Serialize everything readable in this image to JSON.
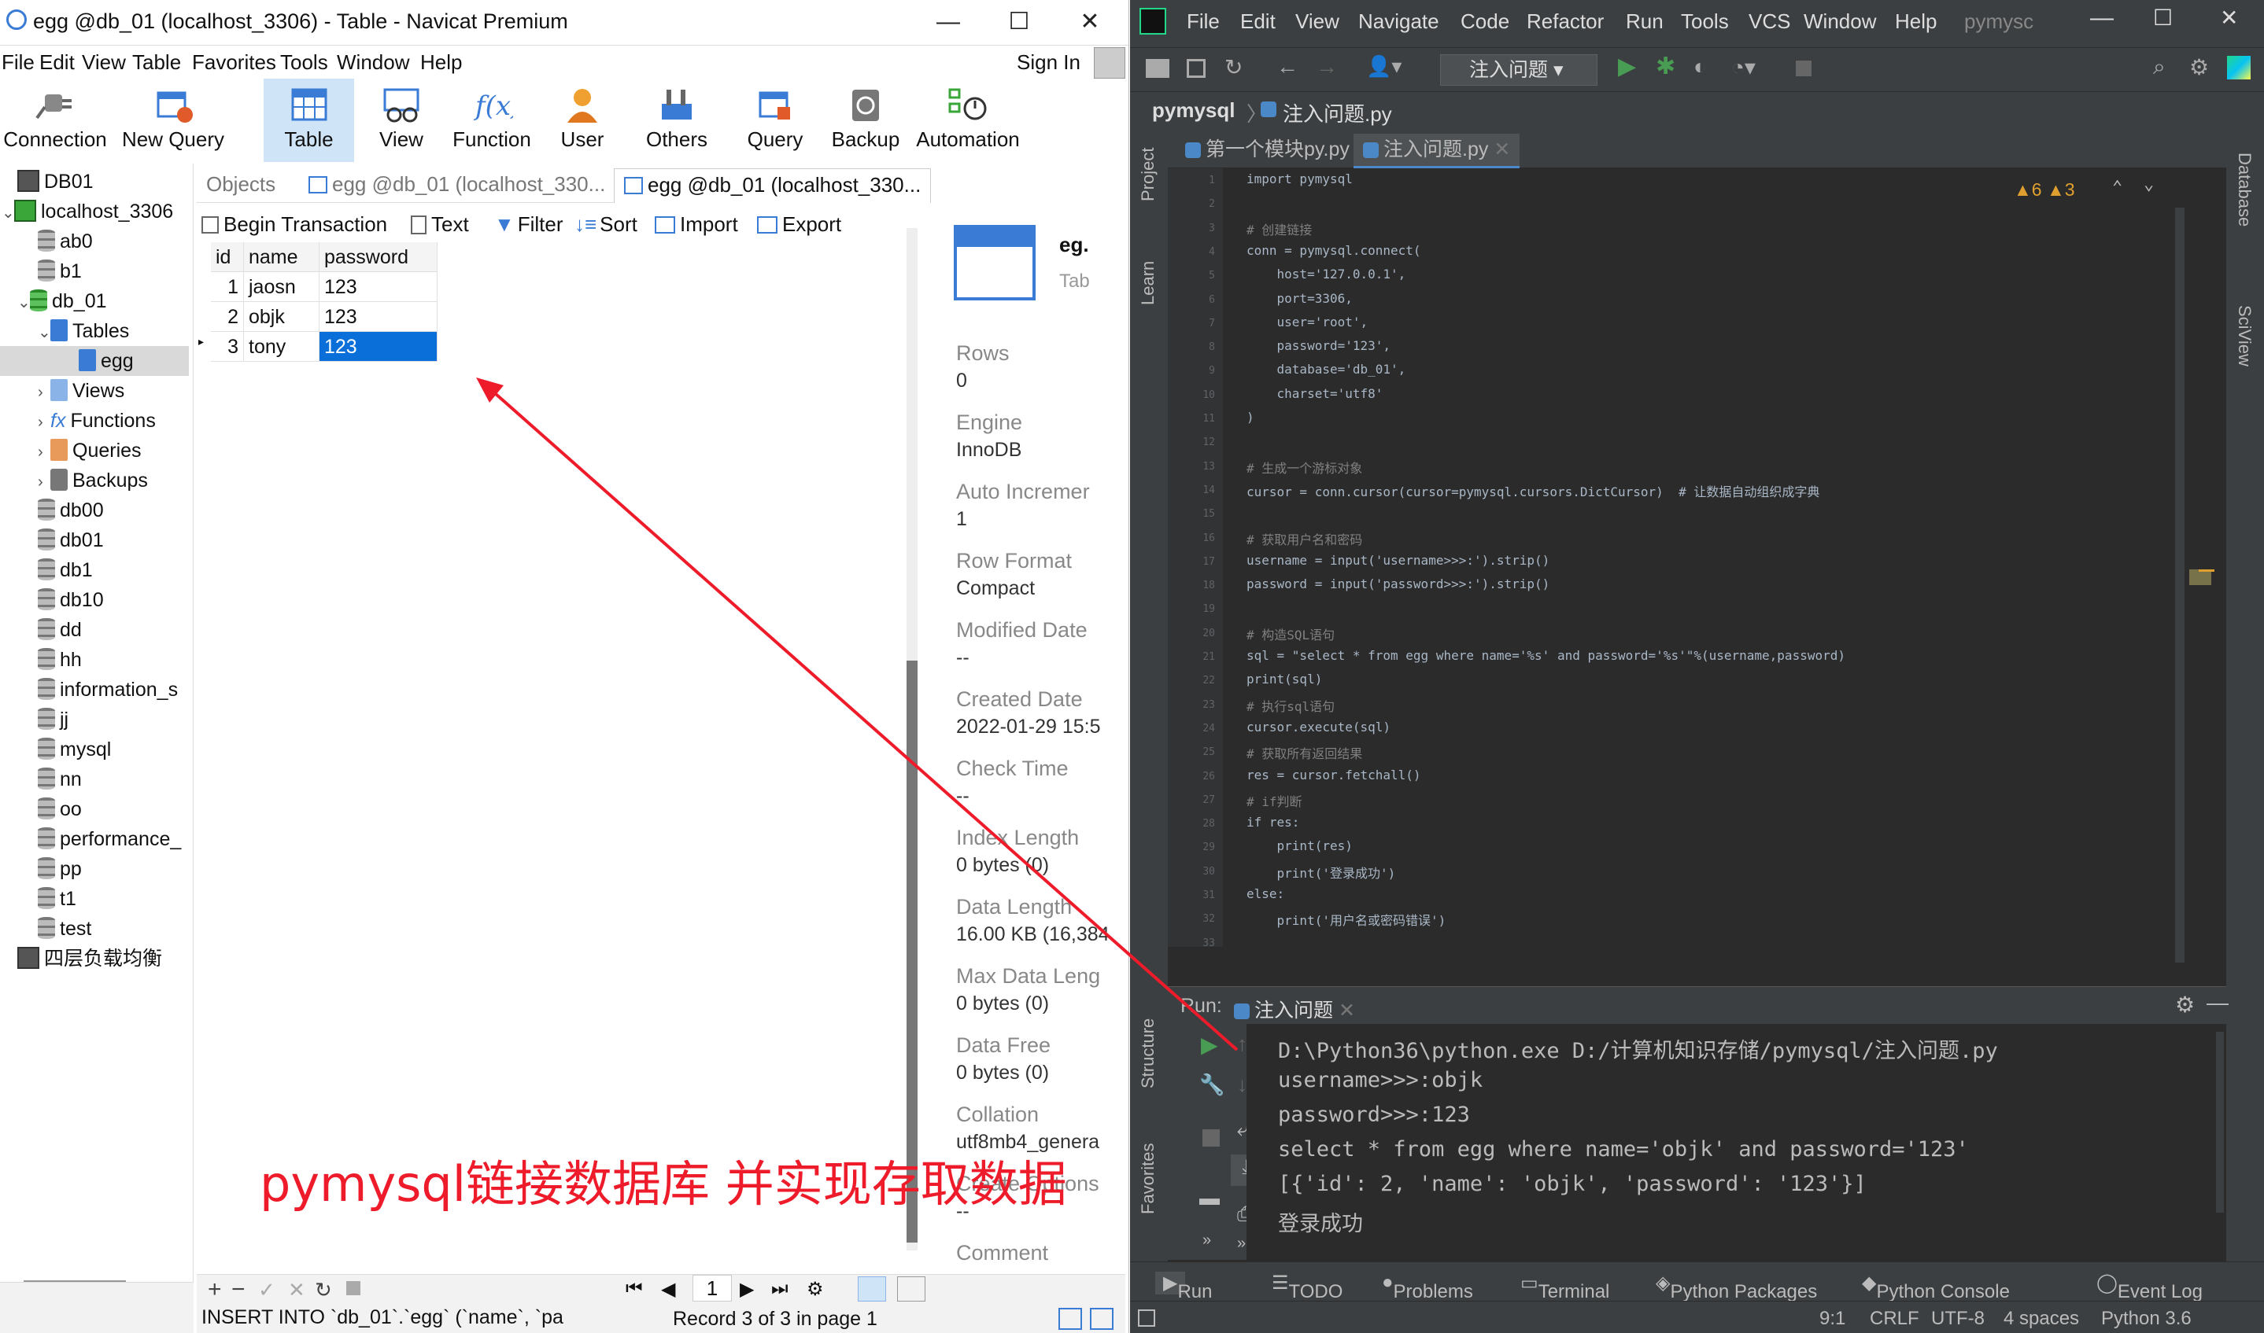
{
  "navicat": {
    "title": "egg @db_01 (localhost_3306) - Table - Navicat Premium",
    "menu": [
      "File",
      "Edit",
      "View",
      "Table",
      "Favorites",
      "Tools",
      "Window",
      "Help"
    ],
    "sign_in": "Sign In",
    "tools": [
      "Connection",
      "New Query",
      "Table",
      "View",
      "Function",
      "User",
      "Others",
      "Query",
      "Backup",
      "Automation"
    ],
    "tree": [
      "DB01",
      "localhost_3306",
      "ab0",
      "b1",
      "db_01",
      "Tables",
      "egg",
      "Views",
      "Functions",
      "Queries",
      "Backups",
      "db00",
      "db01",
      "db1",
      "db10",
      "dd",
      "hh",
      "information_s",
      "jj",
      "mysql",
      "nn",
      "oo",
      "performance_",
      "pp",
      "t1",
      "test",
      "四层负载均衡"
    ],
    "tabs": [
      "Objects",
      "egg @db_01 (localhost_330...",
      "egg @db_01 (localhost_330..."
    ],
    "grid_tools": [
      "Begin Transaction",
      "Text",
      "Filter",
      "Sort",
      "Import",
      "Export"
    ],
    "columns": [
      "id",
      "name",
      "password"
    ],
    "rows": [
      [
        "1",
        "jaosn",
        "123"
      ],
      [
        "2",
        "objk",
        "123"
      ],
      [
        "3",
        "tony",
        "123"
      ]
    ],
    "info": {
      "table_name": "eg.",
      "table_type": "Tab",
      "items": [
        {
          "label": "Rows",
          "value": "0"
        },
        {
          "label": "Engine",
          "value": "InnoDB"
        },
        {
          "label": "Auto Incremer",
          "value": "1"
        },
        {
          "label": "Row Format",
          "value": "Compact"
        },
        {
          "label": "Modified Date",
          "value": "--"
        },
        {
          "label": "Created Date",
          "value": "2022-01-29 15:5"
        },
        {
          "label": "Check Time",
          "value": "--"
        },
        {
          "label": "Index Length",
          "value": "0 bytes (0)"
        },
        {
          "label": "Data Length",
          "value": "16.00 KB (16,384"
        },
        {
          "label": "Max Data Leng",
          "value": "0 bytes (0)"
        },
        {
          "label": "Data Free",
          "value": "0 bytes (0)"
        },
        {
          "label": "Collation",
          "value": "utf8mb4_genera"
        },
        {
          "label": "Create Options",
          "value": "--"
        },
        {
          "label": "Comment",
          "value": "--"
        }
      ]
    },
    "status_sql": "INSERT INTO `db_01`.`egg` (`name`, `pas",
    "page": "1",
    "record": "Record 3 of 3 in page 1",
    "annotation": "pymysql链接数据库 并实现存取数据"
  },
  "pycharm": {
    "menu": [
      "File",
      "Edit",
      "View",
      "Navigate",
      "Code",
      "Refactor",
      "Run",
      "Tools",
      "VCS",
      "Window",
      "Help",
      "pymysc"
    ],
    "run_config": "注入问题",
    "breadcrumb": [
      "pymysql",
      "注入问题.py"
    ],
    "tabs": [
      "第一个模块py.py",
      "注入问题.py"
    ],
    "warnings": "▲6  ▲3",
    "side_left": [
      "Project",
      "Learn",
      "Structure",
      "Favorites"
    ],
    "side_right": [
      "Database",
      "SciView"
    ],
    "code": [
      "import pymysql",
      "",
      "# 创建链接",
      "conn = pymysql.connect(",
      "    host='127.0.0.1',",
      "    port=3306,",
      "    user='root',",
      "    password='123',",
      "    database='db_01',",
      "    charset='utf8'",
      ")",
      "",
      "# 生成一个游标对象",
      "cursor = conn.cursor(cursor=pymysql.cursors.DictCursor)  # 让数据自动组织成字典",
      "",
      "# 获取用户名和密码",
      "username = input('username>>>:').strip()",
      "password = input('password>>>:').strip()",
      "",
      "# 构造SQL语句",
      "sql = \"select * from egg where name='%s' and password='%s'\"%(username,password)",
      "print(sql)",
      "# 执行sql语句",
      "cursor.execute(sql)",
      "# 获取所有返回结果",
      "res = cursor.fetchall()",
      "# if判断",
      "if res:",
      "    print(res)",
      "    print('登录成功')",
      "else:",
      "    print('用户名或密码错误')",
      ""
    ],
    "run_label": "Run:",
    "run_tab": "注入问题",
    "console": [
      "D:\\Python36\\python.exe D:/计算机知识存储/pymysql/注入问题.py",
      "username>>>:objk",
      "password>>>:123",
      "select * from egg where name='objk' and password='123'",
      "[{'id': 2, 'name': 'objk', 'password': '123'}]",
      "登录成功"
    ],
    "bottom_tabs": [
      "Run",
      "TODO",
      "Problems",
      "Terminal",
      "Python Packages",
      "Python Console",
      "Event Log"
    ],
    "status": [
      "9:1",
      "CRLF",
      "UTF-8",
      "4 spaces",
      "Python 3.6"
    ]
  }
}
